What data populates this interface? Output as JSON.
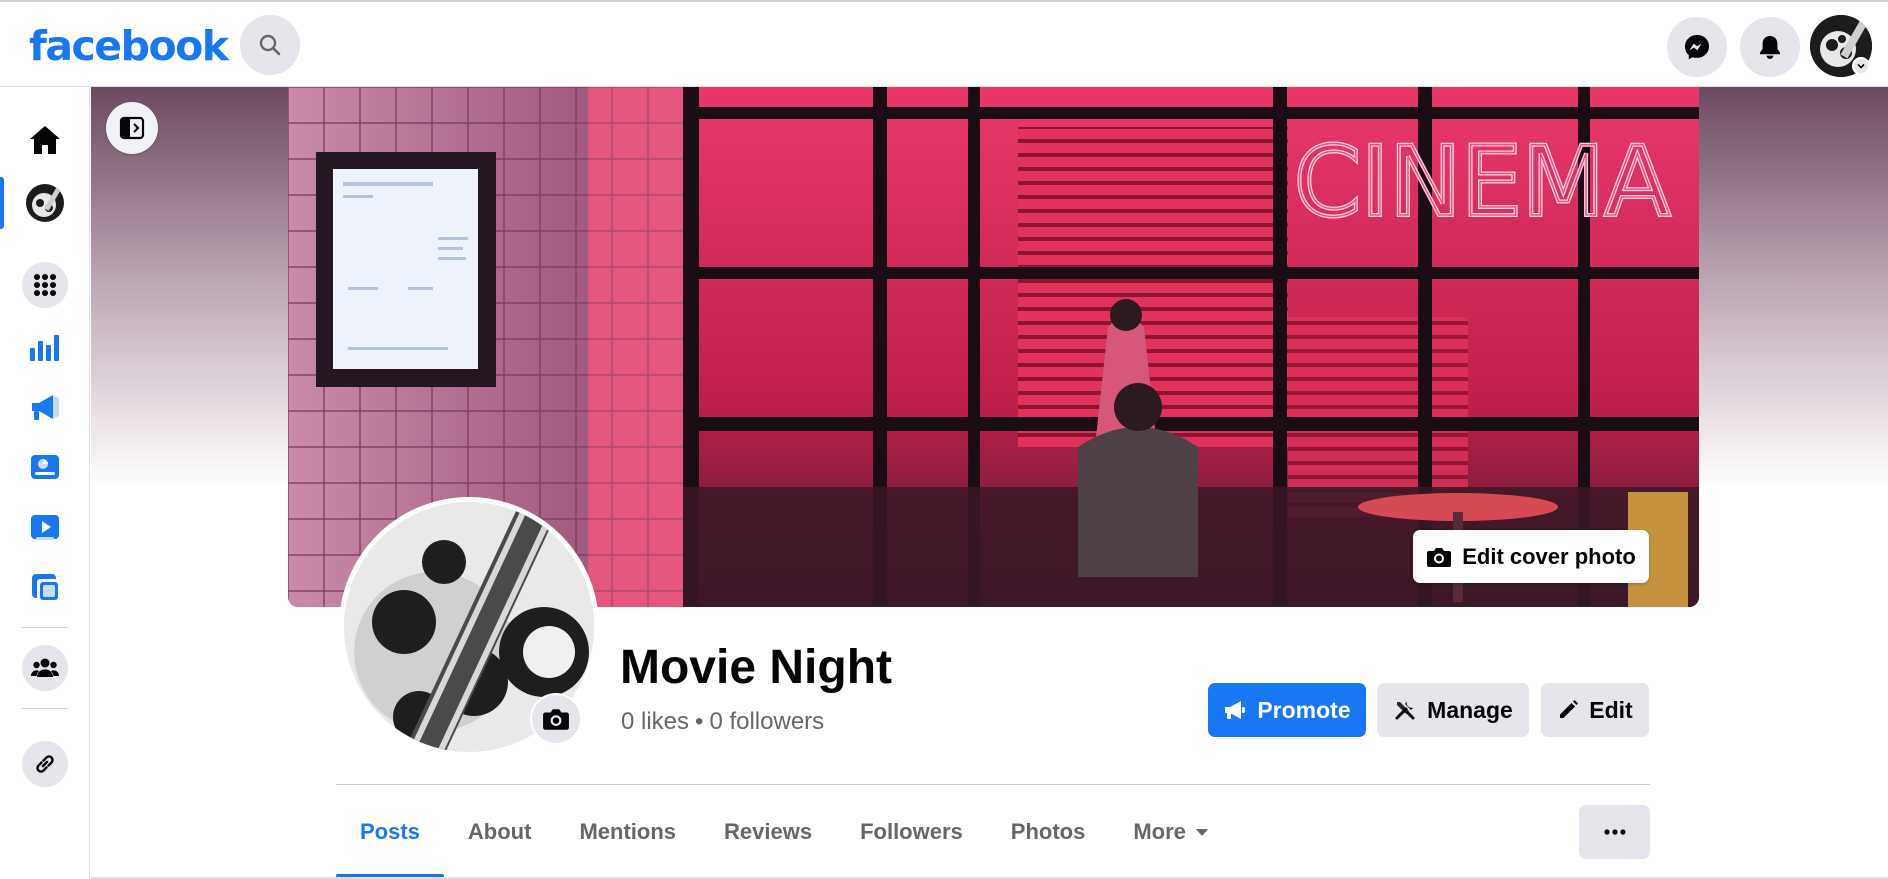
{
  "app": {
    "logo_text": "facebook",
    "brand_color": "#1877f2"
  },
  "header": {
    "search_icon": "search-icon",
    "messenger_icon": "messenger-icon",
    "notifications_icon": "bell-icon",
    "account_icon": "account-avatar"
  },
  "rail": {
    "items": [
      {
        "name": "home",
        "icon": "home-icon"
      },
      {
        "name": "page",
        "icon": "page-avatar",
        "active": true
      },
      {
        "name": "menu",
        "icon": "grid-menu-icon"
      },
      {
        "name": "insights",
        "icon": "bar-chart-icon"
      },
      {
        "name": "ads",
        "icon": "megaphone-icon"
      },
      {
        "name": "meta-business-suite",
        "icon": "business-suite-icon"
      },
      {
        "name": "professional-dashboard",
        "icon": "play-icon"
      },
      {
        "name": "creator-studio",
        "icon": "frame-icon"
      },
      {
        "name": "groups",
        "icon": "groups-icon"
      },
      {
        "name": "link",
        "icon": "link-icon"
      }
    ]
  },
  "cover": {
    "sign_text": "CINEMA",
    "edit_label": "Edit cover photo"
  },
  "profile": {
    "name": "Movie Night",
    "likes": "0 likes",
    "separator": "•",
    "followers": "0 followers"
  },
  "actions": {
    "promote": "Promote",
    "manage": "Manage",
    "edit": "Edit"
  },
  "tabs": [
    {
      "label": "Posts",
      "active": true
    },
    {
      "label": "About"
    },
    {
      "label": "Mentions"
    },
    {
      "label": "Reviews"
    },
    {
      "label": "Followers"
    },
    {
      "label": "Photos"
    },
    {
      "label": "More"
    }
  ],
  "more_menu_icon": "more-dots-icon"
}
